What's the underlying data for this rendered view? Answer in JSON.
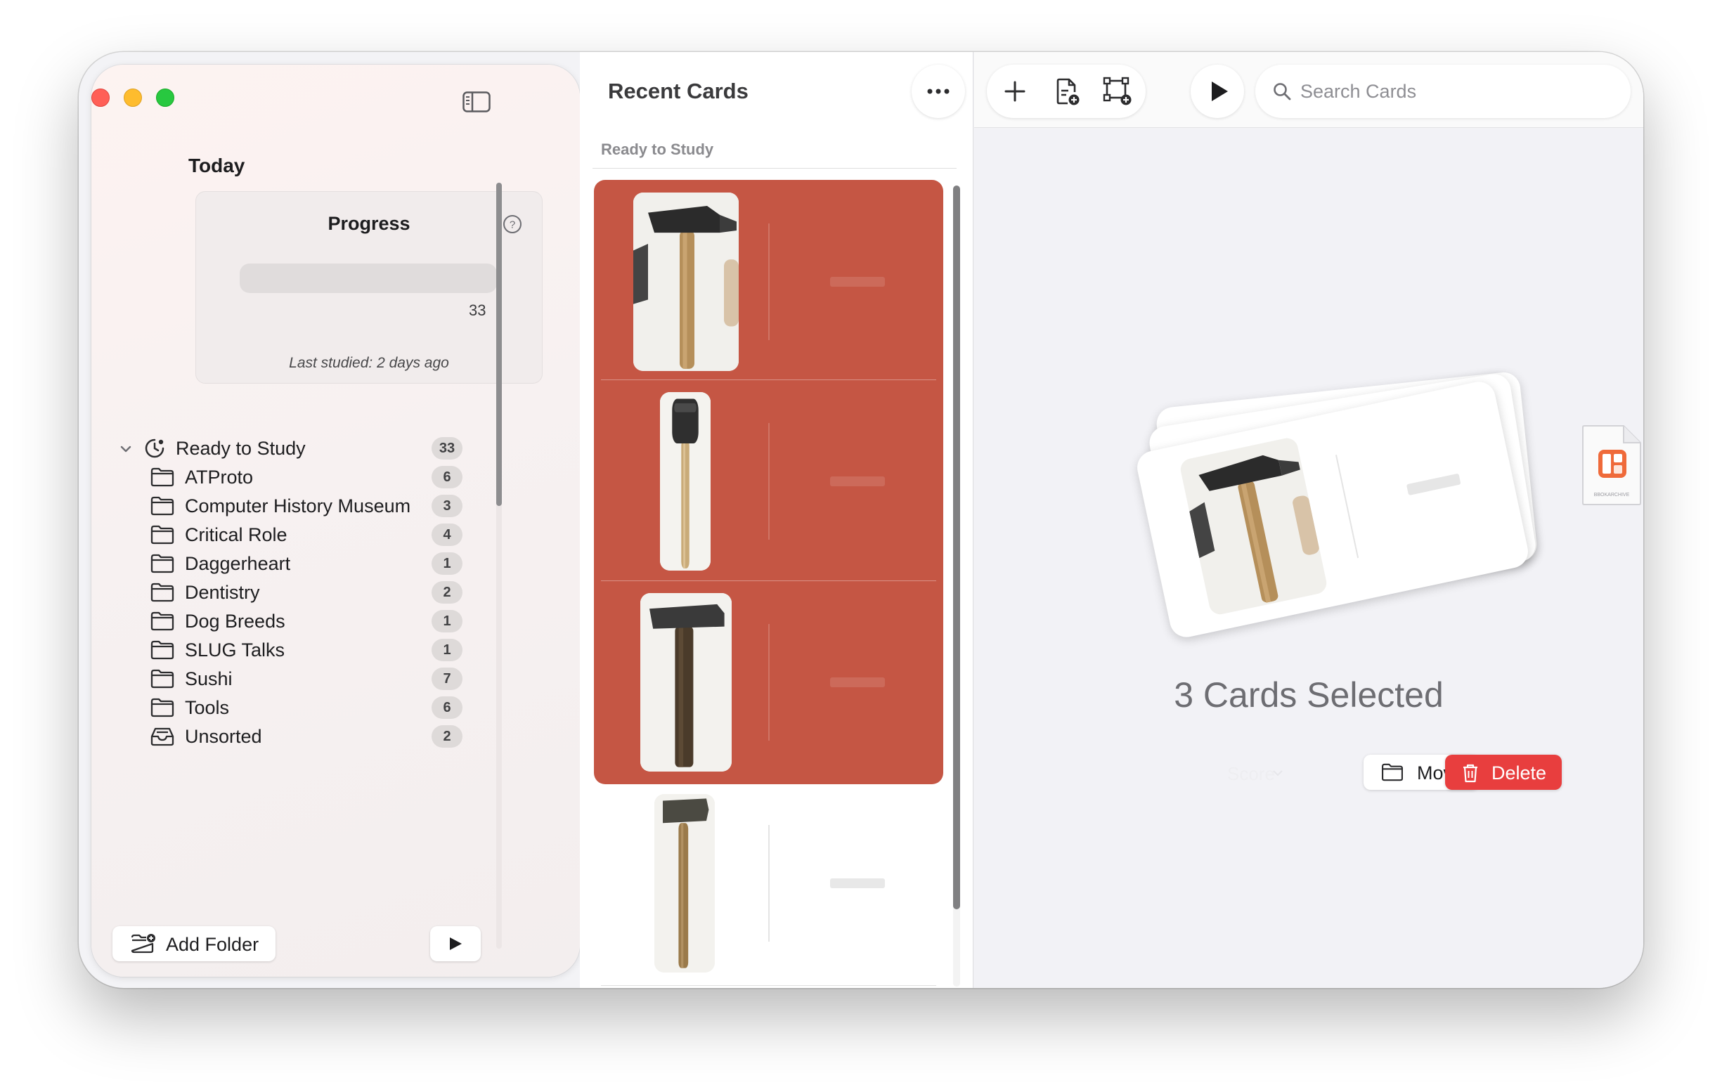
{
  "sidebar": {
    "section_title": "Today",
    "progress": {
      "title": "Progress",
      "count": "33",
      "last_studied": "Last studied: 2 days ago"
    },
    "group": {
      "label": "Ready to Study",
      "count": "33",
      "expanded": true
    },
    "folders": [
      {
        "label": "ATProto",
        "count": "6",
        "icon": "folder-icon"
      },
      {
        "label": "Computer History Museum",
        "count": "3",
        "icon": "folder-icon"
      },
      {
        "label": "Critical Role",
        "count": "4",
        "icon": "folder-icon"
      },
      {
        "label": "Daggerheart",
        "count": "1",
        "icon": "folder-icon"
      },
      {
        "label": "Dentistry",
        "count": "2",
        "icon": "folder-icon"
      },
      {
        "label": "Dog Breeds",
        "count": "1",
        "icon": "folder-icon"
      },
      {
        "label": "SLUG Talks",
        "count": "1",
        "icon": "folder-icon"
      },
      {
        "label": "Sushi",
        "count": "7",
        "icon": "folder-icon"
      },
      {
        "label": "Tools",
        "count": "6",
        "icon": "folder-icon"
      },
      {
        "label": "Unsorted",
        "count": "2",
        "icon": "inbox-icon"
      }
    ],
    "add_folder_label": "Add Folder"
  },
  "list": {
    "title": "Recent Cards",
    "section_header": "Ready to Study",
    "cards": [
      {
        "selected": true,
        "image": "hammer-photo"
      },
      {
        "selected": true,
        "image": "mallet-photo"
      },
      {
        "selected": true,
        "image": "hammer-photo"
      },
      {
        "selected": false,
        "image": "hammer-photo"
      }
    ]
  },
  "detail": {
    "search_placeholder": "Search Cards",
    "selected_count_label": "3 Cards Selected",
    "score_label": "Score",
    "move_label": "Move",
    "delete_label": "Delete",
    "file_icon_label": "BBOKARCHIVE"
  },
  "colors": {
    "selection": "#c55644",
    "delete": "#e83e3e",
    "traffic_red": "#ff5f57",
    "traffic_yellow": "#febc2e",
    "traffic_green": "#28c840"
  }
}
